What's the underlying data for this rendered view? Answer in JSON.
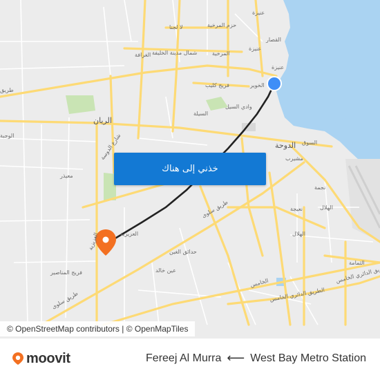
{
  "map": {
    "cta_label": "خذني إلى هناك",
    "attribution": "© OpenStreetMap contributors | © OpenMapTiles",
    "colors": {
      "water": "#aad3f2",
      "land": "#ececec",
      "roads": "#fdda75",
      "park": "#c9e4b4",
      "route_line": "#222222",
      "origin_marker": "#3e8ef7",
      "destination_marker": "#f37021",
      "button": "#1379d4"
    },
    "labels": {
      "l1": "عنيزة",
      "l2": "لا لجنا",
      "l3": "حزم المرخية",
      "l4": "القصار",
      "l5": "عنيزة",
      "l6": "شمال مدينة الخليفة",
      "l7": "المرخية",
      "l8": "الغرافة",
      "l9": "عنيزة",
      "l10": "الخوير",
      "l11": "فريج كليب",
      "l12": "طريق",
      "l13": "وادي السيل",
      "l14": "السيلة",
      "l15": "الريان",
      "l16": "الدوحة",
      "l17": "السوق",
      "l18": "مشيرب",
      "l19": "شارع الدوسة",
      "l20": "معيذر",
      "l21": "نجمة",
      "l22": "الهلال",
      "l23": "نعيجة",
      "l24": "الهلال",
      "l25": "طريق سلوى",
      "l26": "العزيزية",
      "l27": "حدائق الغين",
      "l28": "عين خالد",
      "l29": "الثمامة",
      "l30": "الطريق الدائري الخامس",
      "l31": "الخامس",
      "l32": "الطريق الدائري الخامس",
      "l33": "طريق سلوى",
      "l34": "فريج المناصير",
      "l35": "الوجبة",
      "l36": "العزيزية"
    }
  },
  "footer": {
    "brand": "moovit",
    "origin": "West Bay Metro Station",
    "destination": "Fereej Al Murra",
    "arrow": "⟵"
  }
}
